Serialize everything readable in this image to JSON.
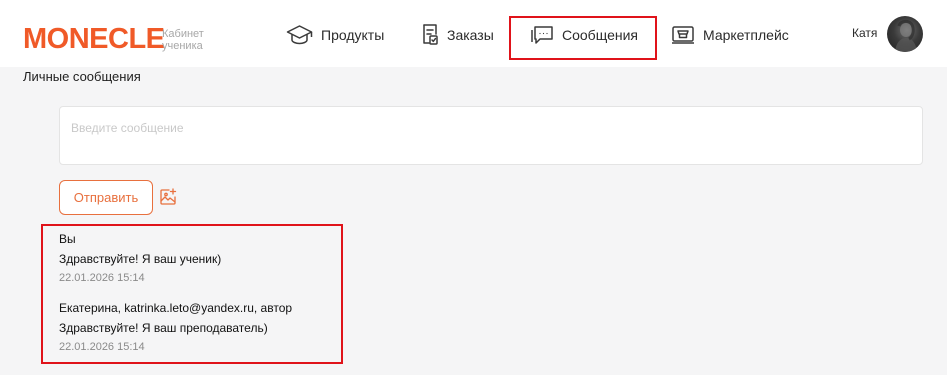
{
  "brand": {
    "logo_text": "MONECLE",
    "subtitle_line1": "Кабинет",
    "subtitle_line2": "ученика",
    "accent_color": "#f05a28"
  },
  "nav": {
    "items": [
      {
        "label": "Продукты",
        "icon": "graduation-cap-icon"
      },
      {
        "label": "Заказы",
        "icon": "order-list-icon"
      },
      {
        "label": "Сообщения",
        "icon": "chat-bubble-icon",
        "active": true
      },
      {
        "label": "Маркетплейс",
        "icon": "storefront-laptop-icon"
      }
    ]
  },
  "user": {
    "name": "Катя"
  },
  "page": {
    "title": "Личные сообщения"
  },
  "composer": {
    "placeholder": "Введите сообщение",
    "value": "",
    "send_label": "Отправить",
    "attach_icon": "image-add-icon"
  },
  "messages": [
    {
      "author": "Вы",
      "text": "Здравствуйте! Я ваш ученик)",
      "time": "22.01.2026 15:14"
    },
    {
      "author": "Екатерина, katrinka.leto@yandex.ru, автор",
      "text": "Здравствуйте! Я ваш преподаватель)",
      "time": "22.01.2026 15:14"
    }
  ],
  "highlight_color": "#e0131a"
}
